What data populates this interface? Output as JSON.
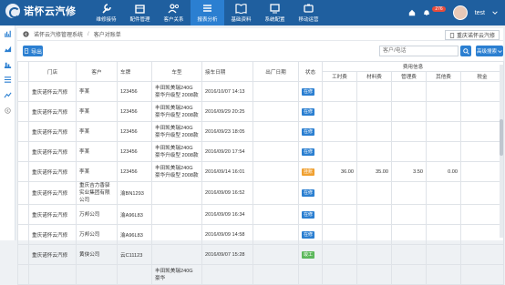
{
  "app": {
    "title": "诺怀云汽修"
  },
  "nav": [
    {
      "label": "维修接待",
      "icon": "wrench-icon",
      "active": false
    },
    {
      "label": "配件管理",
      "icon": "box-icon",
      "active": false
    },
    {
      "label": "客户关系",
      "icon": "users-icon",
      "active": false
    },
    {
      "label": "报表分析",
      "icon": "report-icon",
      "active": true
    },
    {
      "label": "基础资料",
      "icon": "book-icon",
      "active": false
    },
    {
      "label": "系统配置",
      "icon": "settings-icon",
      "active": false
    },
    {
      "label": "移动运营",
      "icon": "mobile-icon",
      "active": false
    }
  ],
  "topright": {
    "notify_count": "276",
    "user": "test"
  },
  "breadcrumb": {
    "root": "诺怀云汽修管理系统",
    "current": "客户对账单"
  },
  "company": {
    "label": "重庆诺怀云汽修"
  },
  "toolbar": {
    "export_label": "导出",
    "search_placeholder": "客户/电话",
    "advanced_label": "高级搜索"
  },
  "table": {
    "headers": [
      "门店",
      "客户",
      "车牌",
      "车型",
      "接车日期",
      "出厂日期",
      "状态",
      "费用信息"
    ],
    "fee_headers": [
      "工时费",
      "材料费",
      "管理费",
      "其他费",
      "税金"
    ],
    "rows": [
      {
        "store": "重庆诺怀云汽修",
        "customer": "李某",
        "plate": "123456",
        "model": "丰田凯美瑞240G 豪华升级型 2008款",
        "in_date": "2016/10/07 14:13",
        "out_date": "",
        "status": "在修",
        "status_color": "#2b7fd1",
        "labor": "",
        "material": "",
        "mgmt": "",
        "other": ""
      },
      {
        "store": "重庆诺怀云汽修",
        "customer": "李某",
        "plate": "123456",
        "model": "丰田凯美瑞240G 豪华升级型 2008款",
        "in_date": "2016/09/29 20:25",
        "out_date": "",
        "status": "在修",
        "status_color": "#2b7fd1",
        "labor": "",
        "material": "",
        "mgmt": "",
        "other": ""
      },
      {
        "store": "重庆诺怀云汽修",
        "customer": "李某",
        "plate": "123456",
        "model": "丰田凯美瑞240G 豪华升级型 2008款",
        "in_date": "2016/09/23 18:05",
        "out_date": "",
        "status": "在修",
        "status_color": "#2b7fd1",
        "labor": "",
        "material": "",
        "mgmt": "",
        "other": ""
      },
      {
        "store": "重庆诺怀云汽修",
        "customer": "李某",
        "plate": "123456",
        "model": "丰田凯美瑞240G 豪华升级型 2008款",
        "in_date": "2016/09/20 17:54",
        "out_date": "",
        "status": "在修",
        "status_color": "#2b7fd1",
        "labor": "",
        "material": "",
        "mgmt": "",
        "other": ""
      },
      {
        "store": "重庆诺怀云汽修",
        "customer": "李某",
        "plate": "123456",
        "model": "丰田凯美瑞240G 豪华升级型 2008款",
        "in_date": "2016/09/14 16:01",
        "out_date": "",
        "status": "挂账",
        "status_color": "#f0a030",
        "labor": "36.00",
        "material": "35.00",
        "mgmt": "3.50",
        "other": "0.00"
      },
      {
        "store": "重庆诺怀云汽修",
        "customer": "重庆吉力香驿实业集团有限公司",
        "plate": "渝BN1293",
        "model": "",
        "in_date": "2016/09/09 16:52",
        "out_date": "",
        "status": "在修",
        "status_color": "#2b7fd1",
        "labor": "",
        "material": "",
        "mgmt": "",
        "other": ""
      },
      {
        "store": "重庆诺怀云汽修",
        "customer": "万邦公司",
        "plate": "渝A96L83",
        "model": "",
        "in_date": "2016/09/09 16:34",
        "out_date": "",
        "status": "在修",
        "status_color": "#2b7fd1",
        "labor": "",
        "material": "",
        "mgmt": "",
        "other": ""
      },
      {
        "store": "重庆诺怀云汽修",
        "customer": "万邦公司",
        "plate": "渝A96L83",
        "model": "",
        "in_date": "2016/09/09 14:58",
        "out_date": "",
        "status": "在修",
        "status_color": "#2b7fd1",
        "labor": "",
        "material": "",
        "mgmt": "",
        "other": ""
      },
      {
        "store": "重庆诺怀云汽修",
        "customer": "黄侠公司",
        "plate": "云C11123",
        "model": "",
        "in_date": "2016/09/07 15:28",
        "out_date": "",
        "status": "竣工",
        "status_color": "#5cb85c",
        "labor": "",
        "material": "",
        "mgmt": "",
        "other": ""
      },
      {
        "store": "",
        "customer": "",
        "plate": "",
        "model": "丰田凯美瑞240G 豪华",
        "in_date": "",
        "out_date": "",
        "status": "",
        "status_color": "#2b7fd1",
        "labor": "",
        "material": "",
        "mgmt": "",
        "other": ""
      }
    ]
  },
  "colors": {
    "topbar": "#1f5f9f",
    "accent": "#2b7fd1"
  }
}
